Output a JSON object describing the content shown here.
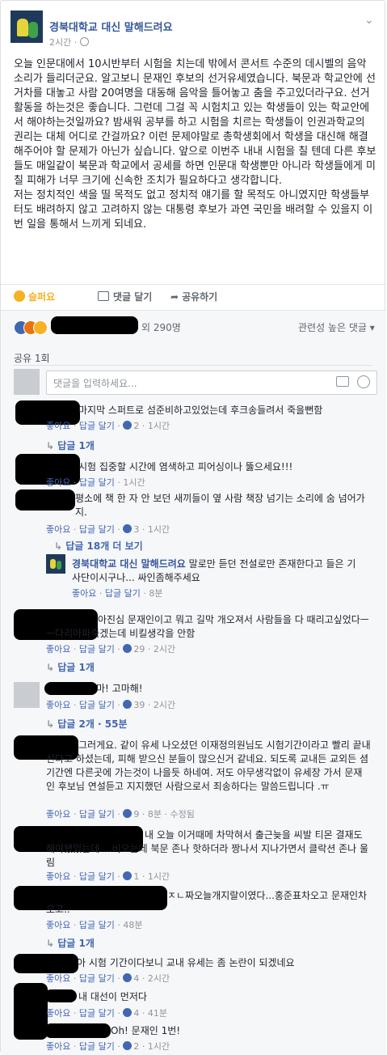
{
  "header": {
    "page_name": "경북대학교 대신 말해드려요",
    "time": "2시간 · ",
    "menu_label": "⌄"
  },
  "post": {
    "paragraph1": "오늘 인문대에서 10시반부터 시험을 치는데 밖에서 콘서트 수준의 데시벨의 음악 소리가 들리더군요. 알고보니 문재인 후보의 선거유세였습니다. 북문과 학교안에 선거차를 대놓고 사람 20여명을 대동해 음악을 틀어놓고 춤을 주고있더라구요. 선거활동을 하는것은 좋습니다. 그런데 그걸 꼭 시험치고 있는 학생들이 있는 학교안에서 해야하는것일까요? 밤새워 공부를 하고 시험을 치르는 학생들이 인권과학교의 권리는 대체 어디로 간걸까요? 이런 문제야말로 총학생회에서 학생을 대신해 해결해주어야 할 문제가 아닌가 싶습니다. 앞으로 이번주 내내 시험을 칠 텐데 다른 후보들도 매일같이 북문과 학교에서 공세를 하면 인문대 학생뿐만 아니라 학생들에게 미칠 피해가 너무 크기에 신속한 조치가 필요하다고 생각합니다.",
    "paragraph2": "저는 정치적인 색을 띨 목적도 없고 정치적 얘기를 할 목적도 아니였지만 학생들부터도 배려하지 않고 고려하지 않는 대통령 후보가 과연 국민을 배려할 수 있을지 이번 일을 통해서 느끼게 되네요."
  },
  "actions": {
    "sad": "슬퍼요",
    "comment": "댓글 달기",
    "share": "공유하기"
  },
  "reactions": {
    "count_text": "외 290명",
    "sort_label": "관련성 높은 댓글 ▾"
  },
  "share_count": "공유 1회",
  "comment_input": {
    "placeholder": "댓글을 입력하세요..."
  },
  "comments": [
    {
      "text": "마지막 스퍼트로 섬준비하고있었는데 후크송들려서 죽을뻔함",
      "like": "좋아요",
      "reply": "답글 달기",
      "likes": "2",
      "time": "1시간",
      "replies": "답글 1개"
    },
    {
      "text": "시험 집중할 시간에 염색하고 피어싱이나 뚫으세요!!!",
      "like": "좋아요",
      "reply": "답글 달기",
      "time": "1시간"
    },
    {
      "text": "평소에 책 한 자 안 보던 새끼들이 옆 사람 책장 넘기는 소리에 숨 넘어가지.",
      "like": "좋아요",
      "reply": "답글 달기",
      "likes": "3",
      "time": "1시간",
      "replies": "답글 18개 더 보기"
    },
    {
      "author": "경북대학교 대신 말해드려요",
      "text": "말로만 듣던 전설로만 존재한다고 들은 기사단이시구나... 싸인좀해주세요",
      "like": "좋아요",
      "reply": "답글 달기",
      "time": "8분"
    },
    {
      "text": "아진심 문재인이고 뭐고 길막 개오져서 사람들을 다 때리고싶었다ㅡㅡ다리아파죽겠는데 비킬생각을 안함",
      "like": "좋아요",
      "reply": "답글 달기",
      "likes": "29",
      "time": "2시간",
      "replies": "답글 1개"
    },
    {
      "text": "마! 고마해!",
      "like": "좋아요",
      "reply": "답글 달기",
      "likes": "39",
      "time": "2시간",
      "replies": "답글 2개 · 55분"
    },
    {
      "text": "그러게요. 같이 유세 나오셨던 이재정의원님도 시험기간이라고 빨리 끝내신다고 하셨는데, 피해 받으신 분들이 많으신거 같네요. 되도록 교내든 교외든 셤기간엔 다른곳에 가는것이 나을듯 하네여. 저도 아무생각없이 유세장 가서 문재인 후보님 연설듣고 지지했던 사람으로서 죄송하다는 말씀드립니다 .ㅠ",
      "like": "좋아요",
      "reply": "답글 달기",
      "likes": "9",
      "time": "8분 · 수정됨"
    },
    {
      "text": "내 오늘 이거때메 차막혀서 출근늦을 씨발 티몬 결재도 해야됐었는데....비오는데 북문 존나 핫하더라 짱나서 지나가면서 클락션 존나 울림",
      "like": "좋아요",
      "reply": "답글 달기",
      "likes": "1",
      "time": "1시간"
    },
    {
      "text": "ㅈㄴ짜오늘개지랄이였다...홍준표차오고 문재인차오고..",
      "like": "좋아요",
      "reply": "답글 달기",
      "time": "48분",
      "replies": "답글 1개"
    },
    {
      "text": "아 시험 기간이다보니 교내 유세는 좀 논란이 되겠네요",
      "like": "좋아요",
      "reply": "답글 달기",
      "likes": "4",
      "time": "2시간"
    },
    {
      "text": "내 대선이 먼저다",
      "like": "좋아요",
      "reply": "답글 달기",
      "likes": "4",
      "time": "41분"
    },
    {
      "text": "Oh! 문재인 1번!",
      "like": "좋아요",
      "reply": "답글 달기",
      "likes": "2",
      "time": "1시간"
    }
  ],
  "colors": {
    "link": "#365899",
    "blue": "#4267b2",
    "muted": "#90949c",
    "bg": "#f6f7f9"
  }
}
